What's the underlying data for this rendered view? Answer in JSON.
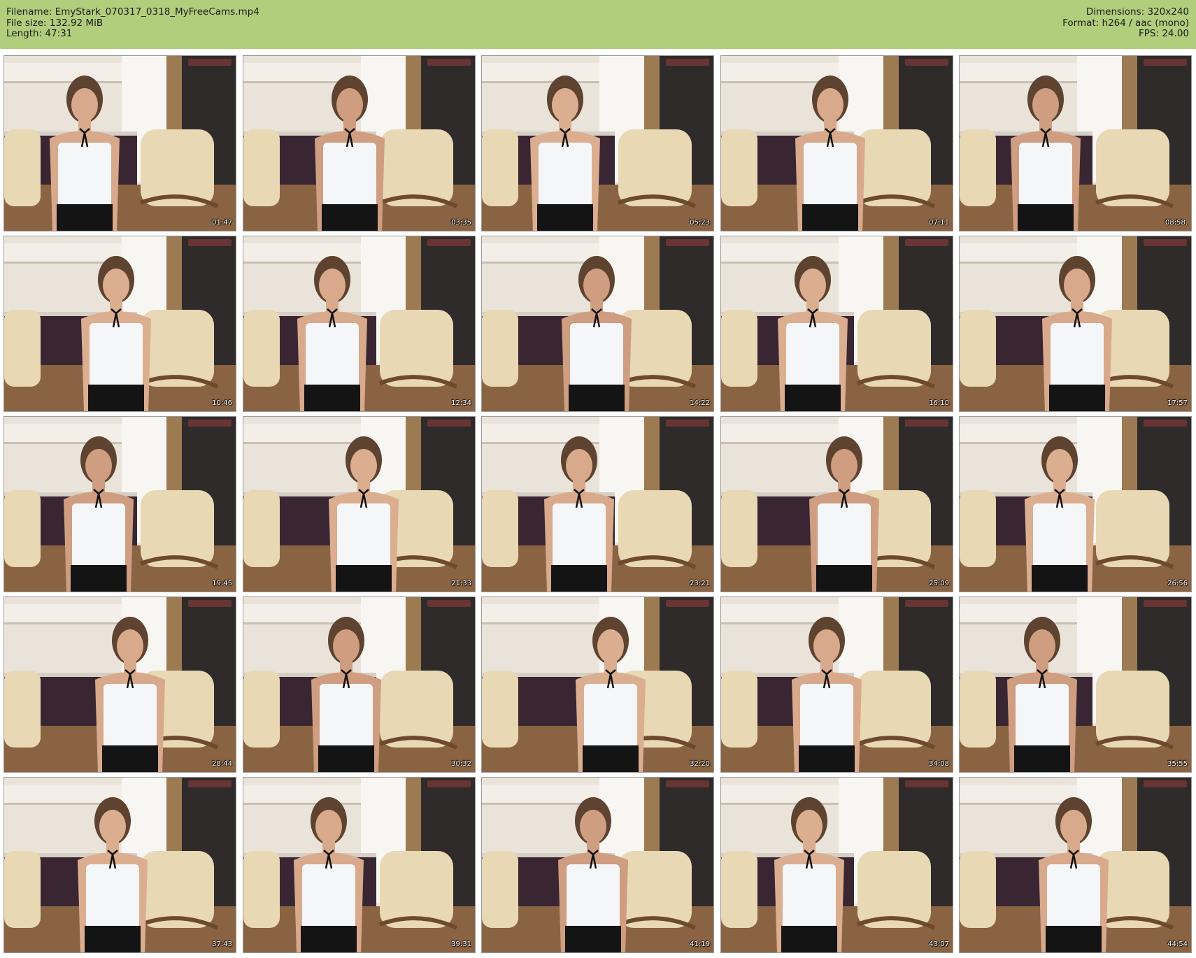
{
  "header": {
    "filename": "Filename: EmyStark_070317_0318_MyFreeCams.mp4",
    "file_size": "File size: 132.92 MiB",
    "length": "Length: 47:31",
    "dimensions": "Dimensions: 320x240",
    "format": "Format: h264 / aac (mono)",
    "fps": "FPS: 24.00"
  },
  "colors": {
    "header_bg": "#b1ce7c",
    "page_bg": "#ffffff",
    "timestamp_text": "#ffffff"
  },
  "thumbnails": [
    {
      "time": "01:47"
    },
    {
      "time": "03:35"
    },
    {
      "time": "05:23"
    },
    {
      "time": "07:11"
    },
    {
      "time": "08:58."
    },
    {
      "time": "10:46"
    },
    {
      "time": "12:34"
    },
    {
      "time": "14:22"
    },
    {
      "time": "16:10"
    },
    {
      "time": "17:57"
    },
    {
      "time": "19:45"
    },
    {
      "time": "21:33"
    },
    {
      "time": "23:21"
    },
    {
      "time": "25:09"
    },
    {
      "time": "26:56"
    },
    {
      "time": "28:44"
    },
    {
      "time": "30:32"
    },
    {
      "time": "32:20"
    },
    {
      "time": "34:08"
    },
    {
      "time": "35:55"
    },
    {
      "time": "37:43"
    },
    {
      "time": "39:31"
    },
    {
      "time": "41:19"
    },
    {
      "time": "43:07"
    },
    {
      "time": "44:54"
    }
  ]
}
